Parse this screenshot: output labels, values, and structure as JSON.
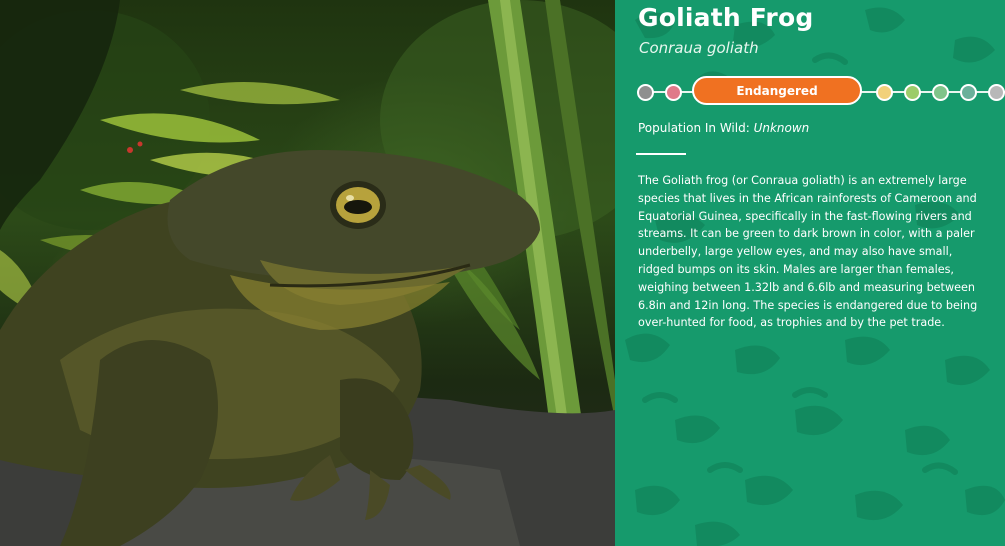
{
  "animal": {
    "common_name": "Goliath Frog",
    "scientific_name": "Conraua goliath"
  },
  "conservation": {
    "status_label": "Endangered",
    "scale_colors_left": [
      "#8f8f8f",
      "#e07a8a"
    ],
    "status_color": "#f07121",
    "scale_colors_right": [
      "#f2d17a",
      "#9ccc6a",
      "#7fc48a",
      "#6ab09a",
      "#b8b8b8"
    ]
  },
  "population": {
    "label": "Population In Wild:",
    "value": "Unknown"
  },
  "description": "The Goliath frog (or Conraua goliath) is an extremely large species that lives in the African rainforests of Cameroon and Equatorial Guinea, specifically in the fast-flowing rivers and streams. It can be green to dark brown in color, with a paler underbelly, large yellow eyes, and may also have small, ridged bumps on its skin. Males are larger than females, weighing between 1.32lb and 6.6lb and measuring between 6.8in and 12in long. The species is endangered due to being over-hunted for food, as trophies and by the pet trade.",
  "colors": {
    "panel_background": "#169a6c",
    "panel_pattern": "#128a5f"
  }
}
